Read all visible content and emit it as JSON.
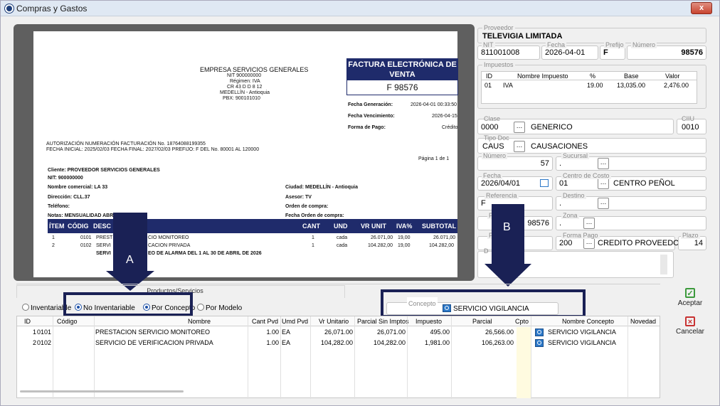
{
  "window": {
    "title": "Compras y Gastos",
    "close_glyph": "x"
  },
  "document": {
    "company_name": "EMPRESA SERVICIOS GENERALES",
    "nit": "NIT 900000000",
    "regimen": "Régimen: IVA",
    "address": "CR 43 D D 8 12",
    "city": "MEDELLÍN - Antioquia",
    "pbx": "PBX: 900101010",
    "title_line1": "FACTURA ELECTRÓNICA DE",
    "title_line2": "VENTA",
    "number": "F 98576",
    "fecha_generacion_label": "Fecha Generación:",
    "fecha_generacion": "2026-04-01 00:33:50",
    "fecha_vencimiento_label": "Fecha Vencimiento:",
    "fecha_vencimiento": "2026-04-15",
    "forma_pago_label": "Forma de Pago:",
    "forma_pago": "Crédito",
    "autorizacion": "AUTORIZACIÓN NUMERACIÓN FACTURACIÓN No. 18764088199355",
    "fecha_inicial": "FECHA INICIAL: 2025/02/03 FECHA FINAL: 2027/02/03 PREFIJO: F DEL No. 80001 AL 120000",
    "pagina": "Página  1  de  1",
    "cliente": "Cliente: PROVEEDOR SERVICIOS GENERALES",
    "cliente_nit": "NIT: 900000000",
    "nombre_comercial": "Nombre comercial: LA 33",
    "direccion": "Dirección: CLL.37",
    "telefono": "Teléfono:",
    "notas": "Notas: MENSUALIDAD ABRIL 2026",
    "ciudad": "Ciudad: MEDELLÍN - Antioquia",
    "asesor": "Asesor: TV",
    "orden_compra": "Orden de compra:",
    "fecha_orden": "Fecha Orden de compra:",
    "columns": [
      "ÍTEM",
      "CÓDIG",
      "DESC",
      "CANT",
      "UND",
      "VR UNIT",
      "IVA%",
      "SUBTOTAL"
    ],
    "items": [
      {
        "item": "1",
        "code": "0101",
        "desc": "PREST",
        "desc2": "CIO MONITOREO",
        "cant": "1",
        "und": "cada",
        "unit": "26.071,00",
        "iva": "19,00",
        "subtotal": "26.071,00"
      },
      {
        "item": "2",
        "code": "0102",
        "desc": "SERVI",
        "desc2": "CACION PRIVADA",
        "cant": "1",
        "und": "cada",
        "unit": "104.282,00",
        "iva": "19,00",
        "subtotal": "104.282,00"
      }
    ],
    "extra_line_a": "SERVI",
    "extra_line_b": "EO DE ALARMA DEL 1 AL 30 DE ABRIL DE 2026"
  },
  "form": {
    "proveedor_label": "Proveedor",
    "proveedor": "TELEVIGIA LIMITADA",
    "nit_label": "NIT",
    "nit": "811001008",
    "fecha_label": "Fecha",
    "fecha": "2026-04-01",
    "prefijo_label": "Prefijo",
    "prefijo": "F",
    "numero_label": "Número",
    "numero": "98576",
    "impuestos_label": "Impuestos",
    "impuestos_cols": [
      "ID",
      "Nombre Impuesto",
      "%",
      "Base",
      "Valor"
    ],
    "impuestos_row": [
      "01",
      "IVA",
      "19.00",
      "13,035.00",
      "2,476.00"
    ],
    "clase_label": "Clase",
    "clase_code": "0000",
    "clase_name": "GENERICO",
    "ciiu_label": "CIIU",
    "ciiu": "0010",
    "tipodoc_label": "Tipo Doc",
    "tipodoc_code": "CAUS",
    "tipodoc_name": "CAUSACIONES",
    "numero2_label": "Número",
    "numero2": "57",
    "sucursal_label": "Sucursal",
    "sucursal": ".",
    "fecha2_label": "Fecha",
    "fecha2": "2026/04/01",
    "centro_label": "Centro de Costo",
    "centro_code": "01",
    "centro_name": "CENTRO PEÑOL",
    "referencia_label": "Referencia",
    "referencia": "F",
    "destino_label": "Destino",
    "destino": ".",
    "zona_label": "Zona",
    "zona": ".",
    "hidden_num": "98576",
    "p_label_1": "P",
    "p_label_2": "P",
    "forma_pago_label": "Forma Pago",
    "forma_pago_code": "200",
    "forma_pago_name": "CREDITO PROVEEDORES",
    "plazo_label": "Plazo",
    "plazo": "14",
    "d_label": "D",
    "concepto_label": "Concepto",
    "concepto": "SERVICIO VIGILANCIA"
  },
  "tabs": {
    "productos": "Productos/Servicios"
  },
  "radios": {
    "inventariable": "Inventariable",
    "no_inventariable": "No Inventariable",
    "por_concepto": "Por Concepto",
    "por_modelo": "Por Modelo"
  },
  "callouts": {
    "a": "A",
    "b": "B"
  },
  "grid": {
    "columns": [
      "ID",
      "Código",
      "Nombre",
      "Cant Pvd",
      "Umd Pvd",
      "Vr Unitario",
      "Parcial Sin Imptos",
      "Impuesto",
      "Parcial",
      "Cpto",
      "Nombre Concepto",
      "Novedad"
    ],
    "rows": [
      {
        "id": "1",
        "code": "0101",
        "name": "PRESTACION SERVICIO MONITOREO",
        "cant": "1.00",
        "umd": "EA",
        "unit": "26,071.00",
        "parcial_sin": "26,071.00",
        "impuesto": "495.00",
        "parcial": "26,566.00",
        "concepto": "SERVICIO VIGILANCIA"
      },
      {
        "id": "2",
        "code": "0102",
        "name": "SERVICIO DE VERIFICACION PRIVADA",
        "cant": "1.00",
        "umd": "EA",
        "unit": "104,282.00",
        "parcial_sin": "104,282.00",
        "impuesto": "1,981.00",
        "parcial": "106,263.00",
        "concepto": "SERVICIO VIGILANCIA"
      }
    ]
  },
  "buttons": {
    "aceptar": "Aceptar",
    "cancelar": "Cancelar"
  },
  "colors": {
    "navy": "#1a2155",
    "invoice_blue": "#1f2b6b",
    "accept_green": "#3c9a3c",
    "cancel_red": "#c83232"
  }
}
